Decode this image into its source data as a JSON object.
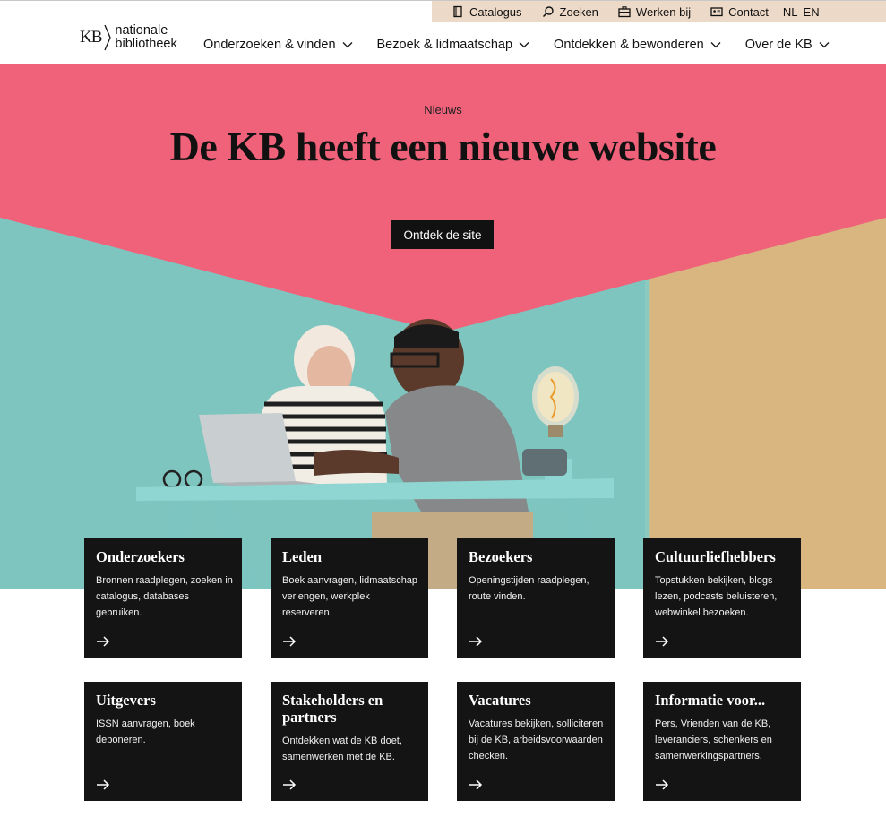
{
  "utility_nav": {
    "items": [
      {
        "label": "Catalogus",
        "icon": "book-icon"
      },
      {
        "label": "Zoeken",
        "icon": "search-icon"
      },
      {
        "label": "Werken bij",
        "icon": "briefcase-icon"
      },
      {
        "label": "Contact",
        "icon": "contact-card-icon"
      }
    ],
    "languages": [
      "NL",
      "EN"
    ]
  },
  "logo": {
    "mark": "KB",
    "line1": "nationale",
    "line2": "bibliotheek"
  },
  "main_nav": [
    {
      "label": "Onderzoeken & vinden"
    },
    {
      "label": "Bezoek & lidmaatschap"
    },
    {
      "label": "Ontdekken & bewonderen"
    },
    {
      "label": "Over de KB"
    }
  ],
  "hero": {
    "label": "Nieuws",
    "title": "De KB heeft een nieuwe website",
    "button": "Ontdek de site",
    "colors": {
      "pink": "#ef627a",
      "teal": "#7fc5bf",
      "sand": "#d9b680",
      "table": "#8fd6d2"
    }
  },
  "cards": [
    {
      "title": "Onderzoekers",
      "text": "Bronnen raadplegen, zoeken in catalogus, databases gebruiken."
    },
    {
      "title": "Leden",
      "text": "Boek aanvragen, lidmaatschap verlengen, werkplek reserveren."
    },
    {
      "title": "Bezoekers",
      "text": "Openingstijden raadplegen, route vinden."
    },
    {
      "title": "Cultuurliefhebbers",
      "text": "Topstukken bekijken, blogs lezen, podcasts beluisteren, webwinkel bezoeken."
    },
    {
      "title": "Uitgevers",
      "text": "ISSN aanvragen, boek deponeren."
    },
    {
      "title": "Stakeholders en partners",
      "text": "Ontdekken wat de KB doet, samenwerken met de KB."
    },
    {
      "title": "Vacatures",
      "text": "Vacatures bekijken, solliciteren bij de KB, arbeidsvoorwaarden checken."
    },
    {
      "title": "Informatie voor...",
      "text": "Pers, Vrienden van de KB, leveranciers, schenkers en samenwerkingspartners."
    }
  ]
}
